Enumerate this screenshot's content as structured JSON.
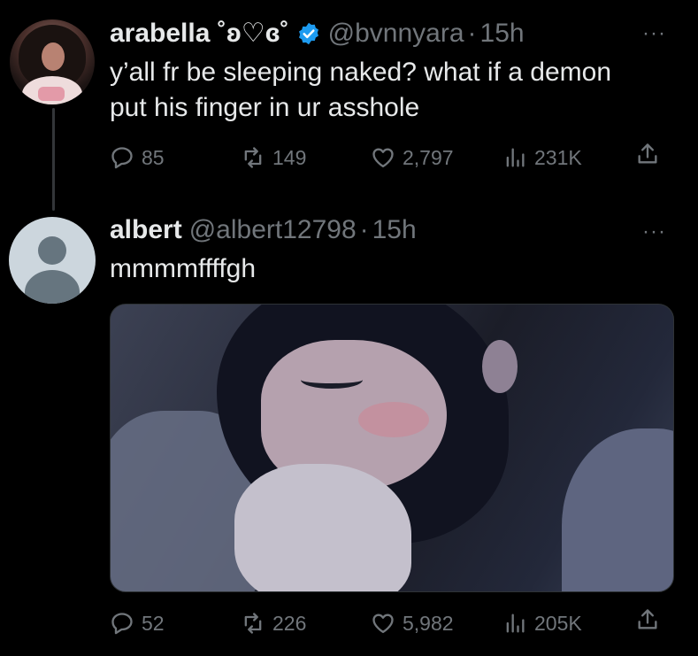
{
  "tweets": [
    {
      "display_name": "arabella ˚ʚ♡ɞ˚",
      "handle": "@bvnnyara",
      "separator": "·",
      "time": "15h",
      "verified": true,
      "text": "y’all fr be sleeping naked? what if a demon\nput his finger in ur asshole",
      "more_label": "···",
      "stats": {
        "replies": "85",
        "reposts": "149",
        "likes": "2,797",
        "views": "231K"
      }
    },
    {
      "display_name": "albert",
      "handle": "@albert12798",
      "separator": "·",
      "time": "15h",
      "verified": false,
      "text": "mmmmffffgh",
      "more_label": "···",
      "has_media": true,
      "stats": {
        "replies": "52",
        "reposts": "226",
        "likes": "5,982",
        "views": "205K"
      }
    }
  ],
  "icons": {
    "reply": "reply-icon",
    "repost": "repost-icon",
    "like": "heart-icon",
    "views": "views-chart-icon",
    "share": "share-icon",
    "verified": "verified-badge-icon",
    "more": "more-options-icon"
  },
  "colors": {
    "background": "#000000",
    "text": "#e7e9ea",
    "muted": "#71767b",
    "verified": "#1d9bf0",
    "thread_line": "#333639"
  }
}
